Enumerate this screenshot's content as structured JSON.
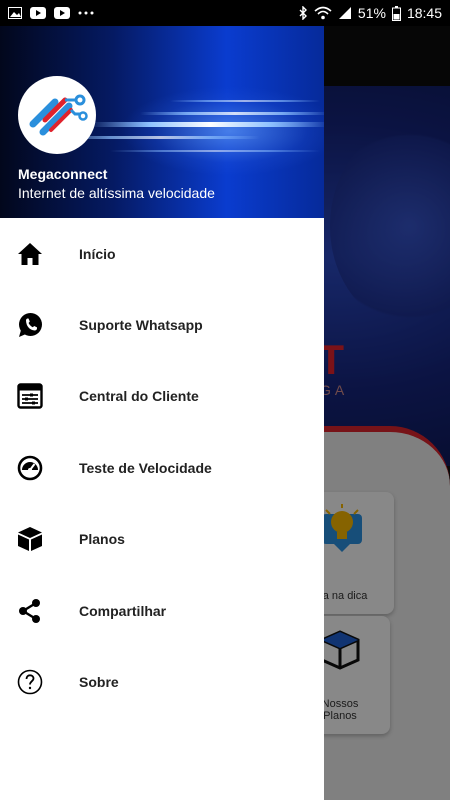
{
  "status_bar": {
    "left_icons": [
      "image-icon",
      "youtube-icon",
      "youtube-icon",
      "more-icon"
    ],
    "right_icons": [
      "bluetooth-icon",
      "wifi-icon",
      "signal-icon",
      "battery-icon"
    ],
    "battery": "51%",
    "time": "18:45"
  },
  "drawer": {
    "title": "Megaconnect",
    "subtitle": "Internet de altíssima velocidade",
    "items": [
      {
        "label": "Início",
        "icon": "home-icon"
      },
      {
        "label": "Suporte Whatsapp",
        "icon": "whatsapp-icon"
      },
      {
        "label": "Central do Cliente",
        "icon": "dashboard-icon"
      },
      {
        "label": "Teste de Velocidade",
        "icon": "speedometer-icon"
      },
      {
        "label": "Planos",
        "icon": "box-icon"
      },
      {
        "label": "Compartilhar",
        "icon": "share-icon"
      },
      {
        "label": "Sobre",
        "icon": "help-icon"
      }
    ]
  },
  "background": {
    "hero_text": "CT",
    "hero_sub": "GA",
    "card_dica": "ga na dica",
    "card_planos": "Nossos\nPlanos"
  },
  "colors": {
    "brand_red": "#d9232c",
    "brand_blue": "#0a3ccf"
  }
}
